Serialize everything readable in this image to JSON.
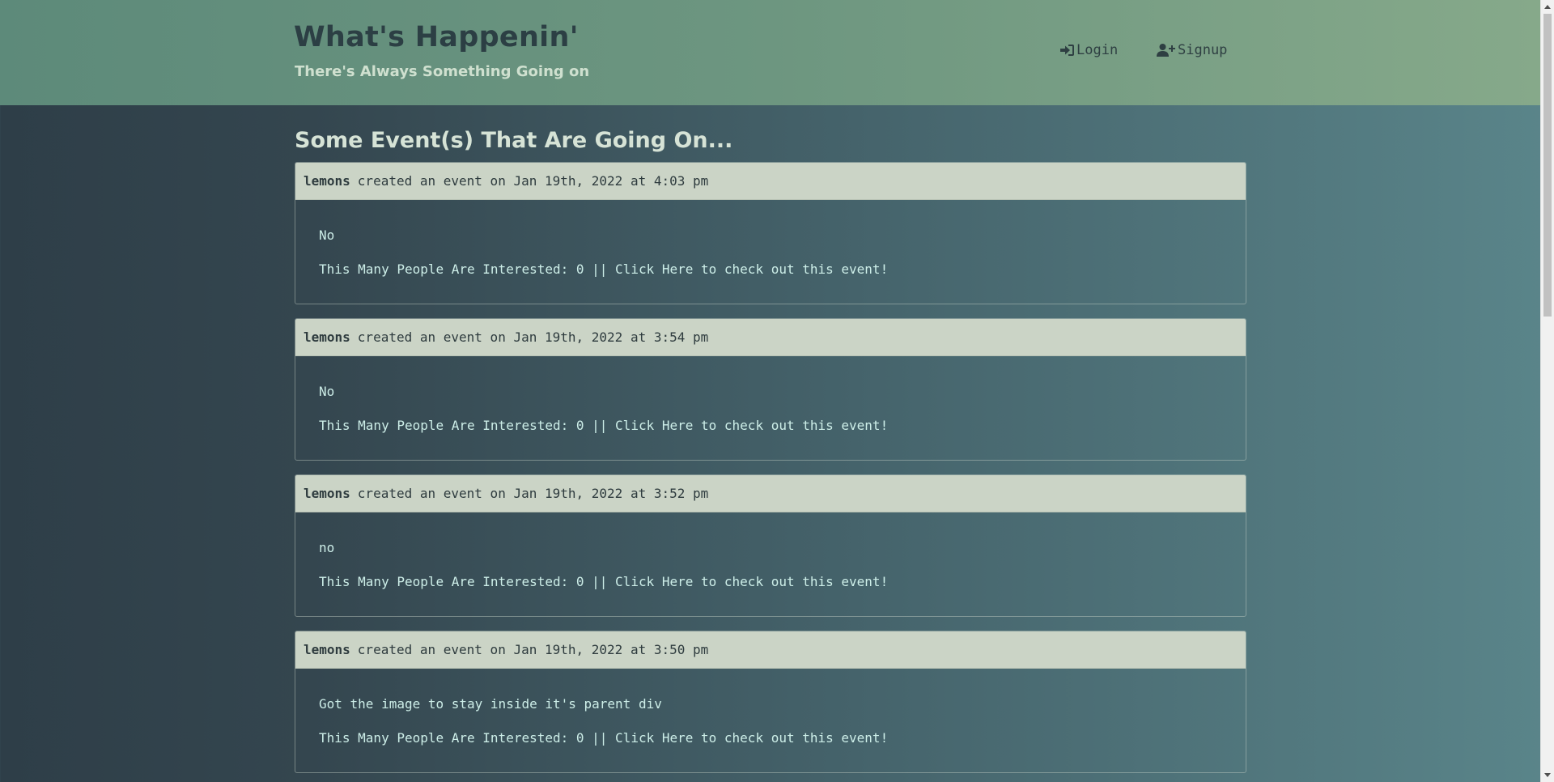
{
  "header": {
    "title": "What's Happenin'",
    "subtitle": "There's Always Something Going on",
    "nav": {
      "login_label": "Login",
      "login_icon": "sign-in-icon",
      "signup_label": "Signup",
      "signup_icon": "user-plus-icon"
    }
  },
  "main": {
    "heading": "Some Event(s) That Are Going On...",
    "events": [
      {
        "author": "lemons",
        "created_text": "created an event on Jan 19th, 2022 at 4:03 pm",
        "description": "No",
        "interest_prefix": "This Many People Are Interested: 0 || ",
        "link_text": "Click Here to check out this event!"
      },
      {
        "author": "lemons",
        "created_text": "created an event on Jan 19th, 2022 at 3:54 pm",
        "description": "No",
        "interest_prefix": "This Many People Are Interested: 0 || ",
        "link_text": "Click Here to check out this event!"
      },
      {
        "author": "lemons",
        "created_text": "created an event on Jan 19th, 2022 at 3:52 pm",
        "description": "no",
        "interest_prefix": "This Many People Are Interested: 0 || ",
        "link_text": "Click Here to check out this event!"
      },
      {
        "author": "lemons",
        "created_text": "created an event on Jan 19th, 2022 at 3:50 pm",
        "description": "Got the image to stay inside it's parent div",
        "interest_prefix": "This Many People Are Interested: 0 || ",
        "link_text": "Click Here to check out this event!"
      }
    ]
  },
  "colors": {
    "header_bg": "#6d9680",
    "card_header_bg": "#cbd4c6",
    "body_text": "#cdeee8",
    "title_text": "#2c3f44"
  }
}
